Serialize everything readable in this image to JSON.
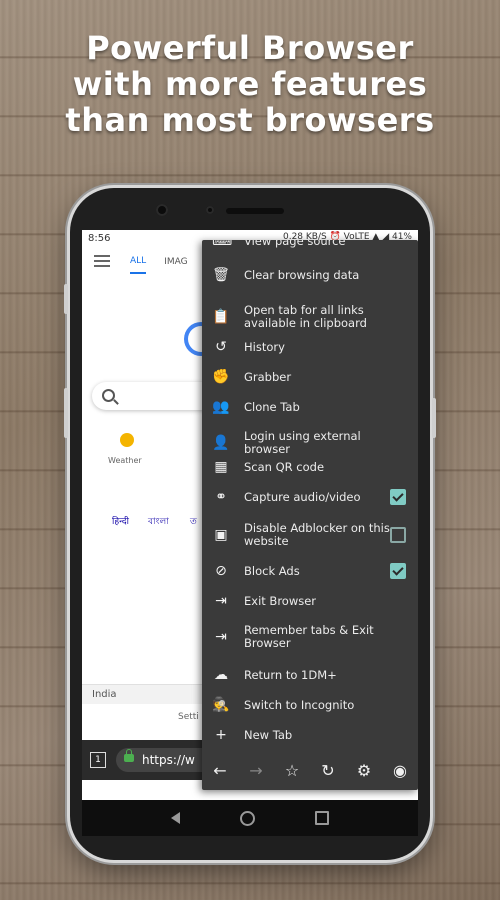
{
  "headline": {
    "line1": "Powerful Browser",
    "line2": "with more features",
    "line3": "than most browsers"
  },
  "status_bar": {
    "time": "8:56",
    "indicators": "0.28 KB/S  ⏰ VoLTE  ▲ ◢ 41%"
  },
  "page": {
    "tabs": [
      "ALL",
      "IMAG"
    ],
    "weather_label": "Weather",
    "languages": [
      "हिन्दी",
      "বাংলা",
      "ত"
    ],
    "region": "India",
    "settings": "Setti"
  },
  "browser_bar": {
    "tab_count": "1",
    "url": "https://w"
  },
  "menu": {
    "items": [
      {
        "label": "View page source",
        "icon": "code-icon",
        "checkbox": null
      },
      {
        "label": "Clear browsing data",
        "icon": "trash-icon",
        "checkbox": null
      },
      {
        "label": "Open tab for all links available in clipboard",
        "icon": "clipboard-icon",
        "checkbox": null
      },
      {
        "label": "History",
        "icon": "history-icon",
        "checkbox": null
      },
      {
        "label": "Grabber",
        "icon": "hand-grab-icon",
        "checkbox": null
      },
      {
        "label": "Clone Tab",
        "icon": "clone-people-icon",
        "checkbox": null
      },
      {
        "label": "Login using external browser",
        "icon": "user-login-icon",
        "checkbox": null
      },
      {
        "label": "Scan QR code",
        "icon": "qr-code-icon",
        "checkbox": null
      },
      {
        "label": "Capture audio/video",
        "icon": "binoculars-icon",
        "checkbox": true
      },
      {
        "label": "Disable Adblocker on this website",
        "icon": "adblock-off-icon",
        "checkbox": false
      },
      {
        "label": "Block Ads",
        "icon": "block-ads-icon",
        "checkbox": true
      },
      {
        "label": "Exit Browser",
        "icon": "exit-icon",
        "checkbox": null
      },
      {
        "label": "Remember tabs & Exit Browser",
        "icon": "exit-remember-icon",
        "checkbox": null
      },
      {
        "label": "Return to 1DM+",
        "icon": "cloud-return-icon",
        "checkbox": null
      },
      {
        "label": "Switch to Incognito",
        "icon": "incognito-icon",
        "checkbox": null
      },
      {
        "label": "New Tab",
        "icon": "plus-icon",
        "checkbox": null
      }
    ],
    "nav": [
      {
        "name": "back-arrow-icon",
        "glyph": "←"
      },
      {
        "name": "forward-arrow-icon",
        "glyph": "→"
      },
      {
        "name": "star-icon",
        "glyph": "☆"
      },
      {
        "name": "refresh-icon",
        "glyph": "↻"
      },
      {
        "name": "gear-icon",
        "glyph": "⚙"
      },
      {
        "name": "eye-icon",
        "glyph": "◉"
      }
    ]
  },
  "colors": {
    "menu_bg": "#3a3a3a",
    "checkbox_accent": "#80cbc4",
    "link_blue": "#1a73e8"
  }
}
